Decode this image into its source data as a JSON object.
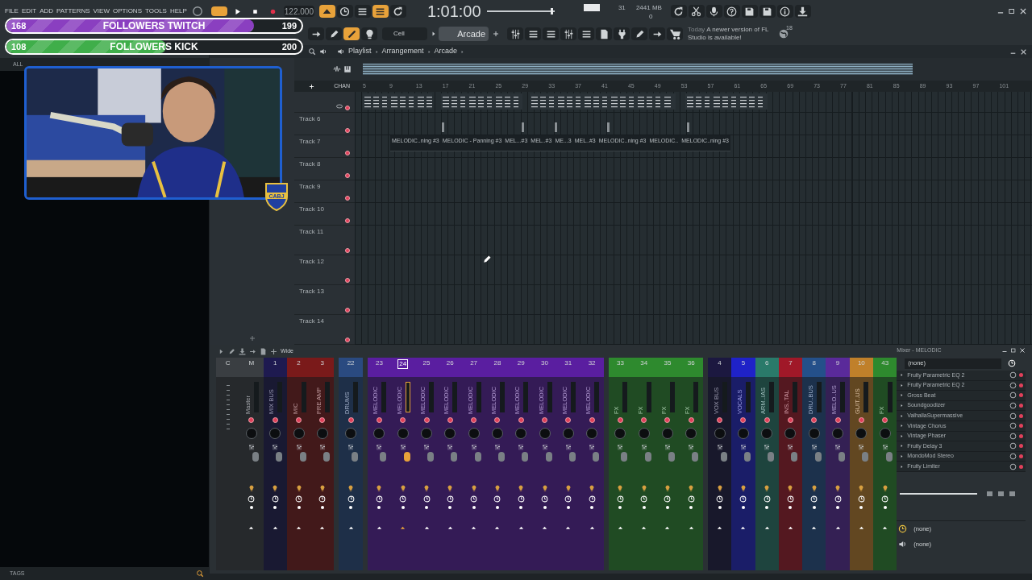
{
  "menu": [
    "FILE",
    "EDIT",
    "ADD",
    "PATTERNS",
    "VIEW",
    "OPTIONS",
    "TOOLS",
    "HELP"
  ],
  "transport": {
    "tempo": "122.000",
    "time": "1:01:00",
    "cpu": "31",
    "memory": "2441 MB",
    "polyphony": "0",
    "master": {
      "level": 0.97
    }
  },
  "pattern": {
    "channel": "Cell",
    "name": "Arcade"
  },
  "news": {
    "day": "Today",
    "message": "A newer version of FL Studio is available!",
    "count": "18"
  },
  "browser": {
    "tab": "ALL",
    "footer": "TAGS"
  },
  "overlay": {
    "goals": [
      {
        "label": "FOLLOWERS TWITCH",
        "count": "168",
        "goal": "199",
        "level": 0.84,
        "color": "#8a3fc0"
      },
      {
        "label": "FOLLOWERS KICK",
        "count": "108",
        "goal": "200",
        "level": 0.54,
        "color": "#3fae4a"
      }
    ],
    "badge": "CABJ"
  },
  "playlist": {
    "breadcrumb": [
      "Playlist",
      "Arrangement",
      "Arcade"
    ],
    "header_label": "CHAN",
    "ruler": [
      "5",
      "9",
      "13",
      "17",
      "21",
      "25",
      "29",
      "33",
      "37",
      "41",
      "45",
      "49",
      "53",
      "57",
      "61",
      "65",
      "69",
      "73",
      "77",
      "81",
      "85",
      "89",
      "93",
      "97",
      "101"
    ],
    "tracks": [
      "Track 6",
      "Track 7",
      "Track 8",
      "Track 9",
      "Track 10",
      "Track 11",
      "Track 12",
      "Track 13",
      "Track 14"
    ],
    "clips": [
      "MELODIC..ning #3",
      "MELODIC - Panning #3",
      "MEL...#3",
      "MEL..#3",
      "ME...3",
      "MEL..#3",
      "MELODIC..ning #3",
      "MELODIC..",
      "MELODIC..ning #3"
    ]
  },
  "mixer": {
    "mode": "Wide",
    "title": "Mixer - MELODIC",
    "groups": [
      [
        {
          "kind": "scale",
          "number": "C",
          "color": "#3a3e42",
          "selected": false
        },
        {
          "kind": "channel",
          "number": "M",
          "name": "Master",
          "color": "#3a3e42",
          "selected": false
        },
        {
          "kind": "channel",
          "number": "1",
          "name": "MIX BUS",
          "color": "#1e1a50",
          "selected": false
        },
        {
          "kind": "channel",
          "number": "2",
          "name": "MIC",
          "color": "#7a1a1a",
          "selected": false
        },
        {
          "kind": "channel",
          "number": "3",
          "name": "PRE AMP",
          "color": "#7a1a1a",
          "selected": false
        }
      ],
      [
        {
          "kind": "channel",
          "number": "22",
          "name": "DRUMS",
          "color": "#2a4a80",
          "selected": false
        }
      ],
      [
        {
          "kind": "channel",
          "number": "23",
          "name": "MELODIC",
          "color": "#5a1ea0",
          "selected": false
        },
        {
          "kind": "channel",
          "number": "24",
          "name": "MELODIC",
          "color": "#5a1ea0",
          "selected": true
        },
        {
          "kind": "channel",
          "number": "25",
          "name": "MELODIC",
          "color": "#5a1ea0",
          "selected": false
        },
        {
          "kind": "channel",
          "number": "26",
          "name": "MELODIC",
          "color": "#5a1ea0",
          "selected": false
        },
        {
          "kind": "channel",
          "number": "27",
          "name": "MELODIC",
          "color": "#5a1ea0",
          "selected": false
        },
        {
          "kind": "channel",
          "number": "28",
          "name": "MELODIC",
          "color": "#5a1ea0",
          "selected": false
        },
        {
          "kind": "channel",
          "number": "29",
          "name": "MELODIC",
          "color": "#5a1ea0",
          "selected": false
        },
        {
          "kind": "channel",
          "number": "30",
          "name": "MELODIC",
          "color": "#5a1ea0",
          "selected": false
        },
        {
          "kind": "channel",
          "number": "31",
          "name": "MELODIC",
          "color": "#5a1ea0",
          "selected": false
        },
        {
          "kind": "channel",
          "number": "32",
          "name": "MELODIC",
          "color": "#5a1ea0",
          "selected": false
        }
      ],
      [
        {
          "kind": "channel",
          "number": "33",
          "name": "FX",
          "color": "#2e8a2e",
          "selected": false
        },
        {
          "kind": "channel",
          "number": "34",
          "name": "FX",
          "color": "#2e8a2e",
          "selected": false
        },
        {
          "kind": "channel",
          "number": "35",
          "name": "FX",
          "color": "#2e8a2e",
          "selected": false
        },
        {
          "kind": "channel",
          "number": "36",
          "name": "FX",
          "color": "#2e8a2e",
          "selected": false
        }
      ],
      [
        {
          "kind": "channel",
          "number": "4",
          "name": "VOX BUS",
          "color": "#1c1840",
          "selected": false
        },
        {
          "kind": "channel",
          "number": "5",
          "name": "VOCALS",
          "color": "#1f22c8",
          "selected": false
        },
        {
          "kind": "channel",
          "number": "6",
          "name": "ARM..IAS",
          "color": "#2a7a6a",
          "selected": false
        },
        {
          "kind": "channel",
          "number": "7",
          "name": "INS..TAL",
          "color": "#a01828",
          "selected": false
        },
        {
          "kind": "channel",
          "number": "8",
          "name": "DRU..BUS",
          "color": "#24508a",
          "selected": false
        },
        {
          "kind": "channel",
          "number": "9",
          "name": "MELO..US",
          "color": "#5a2a9a",
          "selected": false
        },
        {
          "kind": "channel",
          "number": "10",
          "name": "GUIT..US",
          "color": "#c0802a",
          "selected": false
        },
        {
          "kind": "channel",
          "number": "43",
          "name": "FX",
          "color": "#2e8a2e",
          "selected": false
        }
      ]
    ],
    "slot_header": "(none)",
    "effects": [
      "Fruity Parametric EQ 2",
      "Fruity Parametric EQ 2",
      "Gross Beat",
      "Soundgoodizer",
      "ValhallaSupermassive",
      "Vintage Chorus",
      "Vintage Phaser",
      "Fruity Delay 3",
      "MondoMod Stereo",
      "Fruity Limiter"
    ],
    "eq": "(none)",
    "output": "(none)"
  }
}
